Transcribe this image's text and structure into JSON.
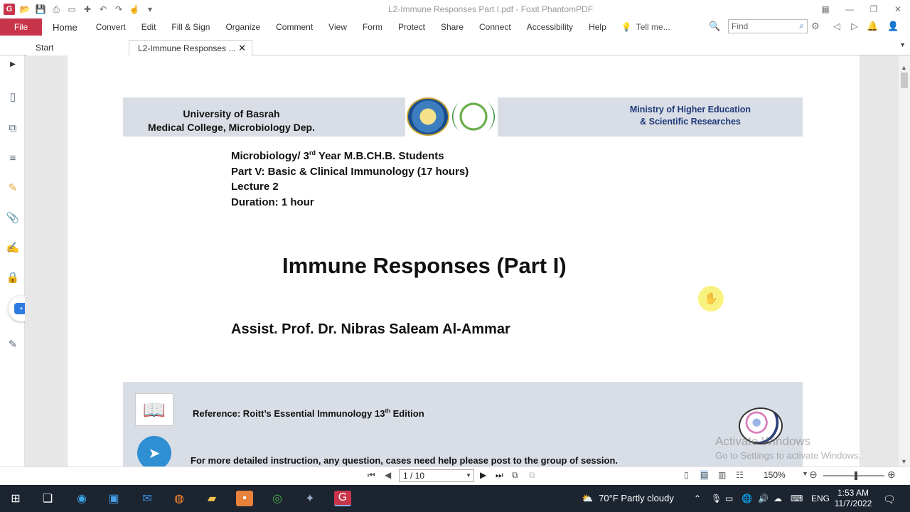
{
  "app": {
    "window_title": "L2-Immune Responses Part I.pdf - Foxit PhantomPDF",
    "logo_letter": "G"
  },
  "ribbon": {
    "file_label": "File",
    "tabs": [
      "Home",
      "Convert",
      "Edit",
      "Fill & Sign",
      "Organize",
      "Comment",
      "View",
      "Form",
      "Protect",
      "Share",
      "Connect",
      "Accessibility",
      "Help"
    ],
    "tell_me": "Tell me...",
    "find_placeholder": "Find"
  },
  "doc_tabs": [
    {
      "label": "Start"
    },
    {
      "label": "L2-Immune Responses ..."
    }
  ],
  "page": {
    "header_left_line1": "University of Basrah",
    "header_left_line2": "Medical College, Microbiology Dep.",
    "header_right_line1": "Ministry of Higher Education",
    "header_right_line2": "& Scientific Researches",
    "course_pre": "Microbiology/ 3",
    "course_sup": "rd",
    "course_post": " Year M.B.CH.B. Students",
    "part": "Part V:  Basic & Clinical Immunology (17 hours)",
    "lecture": "Lecture 2",
    "duration": "Duration: 1 hour",
    "title": "Immune Responses (Part I)",
    "author": "Assist. Prof. Dr. Nibras Saleam Al-Ammar",
    "reference_pre": "Reference: Roitt’s Essential Immunology  13",
    "reference_sup": "th",
    "reference_post": " Edition",
    "telegram_note": "For more detailed instruction, any question, cases need help please post to the group of session."
  },
  "watermark": {
    "line1": "Activate Windows",
    "line2": "Go to Settings to activate Windows."
  },
  "navigation": {
    "page_indicator": "1 / 10",
    "zoom": "150%"
  },
  "taskbar": {
    "weather": "70°F  Partly cloudy",
    "language": "ENG",
    "time": "1:53 AM",
    "date": "11/7/2022"
  },
  "colors": {
    "accent": "#c8354a",
    "header_band": "#d9dee6",
    "ministry_text": "#1f3a7a"
  }
}
